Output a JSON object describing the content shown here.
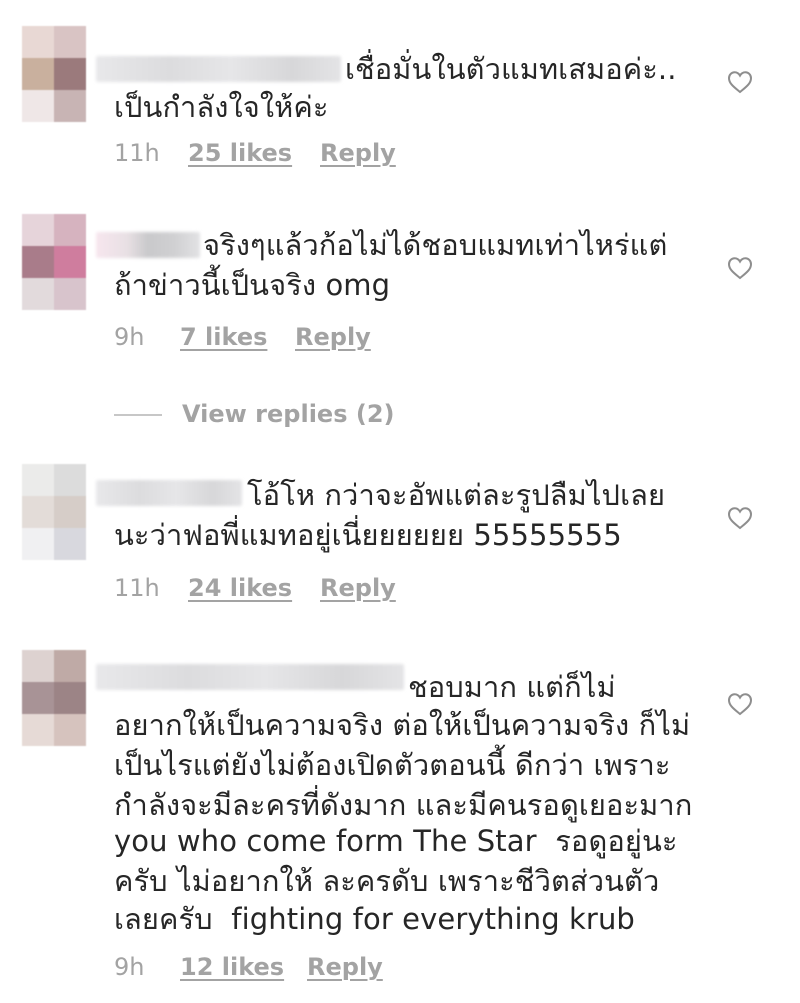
{
  "comments": [
    {
      "text_line1": "เชื่อมั่นในตัวแมทเสมอค่ะ..",
      "text_line2": "เป็นกำลังใจให้ค่ะ",
      "time": "11h",
      "likes": "25 likes",
      "reply": "Reply"
    },
    {
      "text_line1": "จริงๆแล้วก้อไม่ได้ชอบแมทเท่าไหร่แต่",
      "text_line2": "ถ้าข่าวนี้เป็นจริง omg",
      "time": "9h",
      "likes": "7 likes",
      "reply": "Reply"
    },
    {
      "text_line1": "โอ้โห กว่าจะอัพแต่ละรูปลืมไปเลย",
      "text_line2": "นะว่าฟอพี่แมทอยู่เนี่ยยยยยย 55555555",
      "time": "11h",
      "likes": "24 likes",
      "reply": "Reply"
    },
    {
      "text_line1": "ชอบมาก แต่ก็ไม่",
      "text_line2": "อยากให้เป็นความจริง ต่อให้เป็นความจริง ก็ไม่",
      "text_line3": "เป็นไรแต่ยังไม่ต้องเปิดตัวตอนนี้ ดีกว่า เพราะ",
      "text_line4": "กำลังจะมีละครที่ดังมาก และมีคนรอดูเยอะมาก",
      "text_line5": "you who come form The Star  รอดูอยู่นะ",
      "text_line6": "ครับ ไม่อยากให้ ละครดับ เพราะชีวิตส่วนตัว",
      "text_line7": "เลยครับ  fighting for everything krub",
      "time": "9h",
      "likes": "12 likes",
      "reply": "Reply"
    }
  ],
  "view_replies": "View replies (2)",
  "icons": {
    "like": "heart-outline-icon"
  },
  "colors": {
    "text": "#262626",
    "meta": "#a3a3a3",
    "heart_stroke": "#8e8e8e"
  }
}
